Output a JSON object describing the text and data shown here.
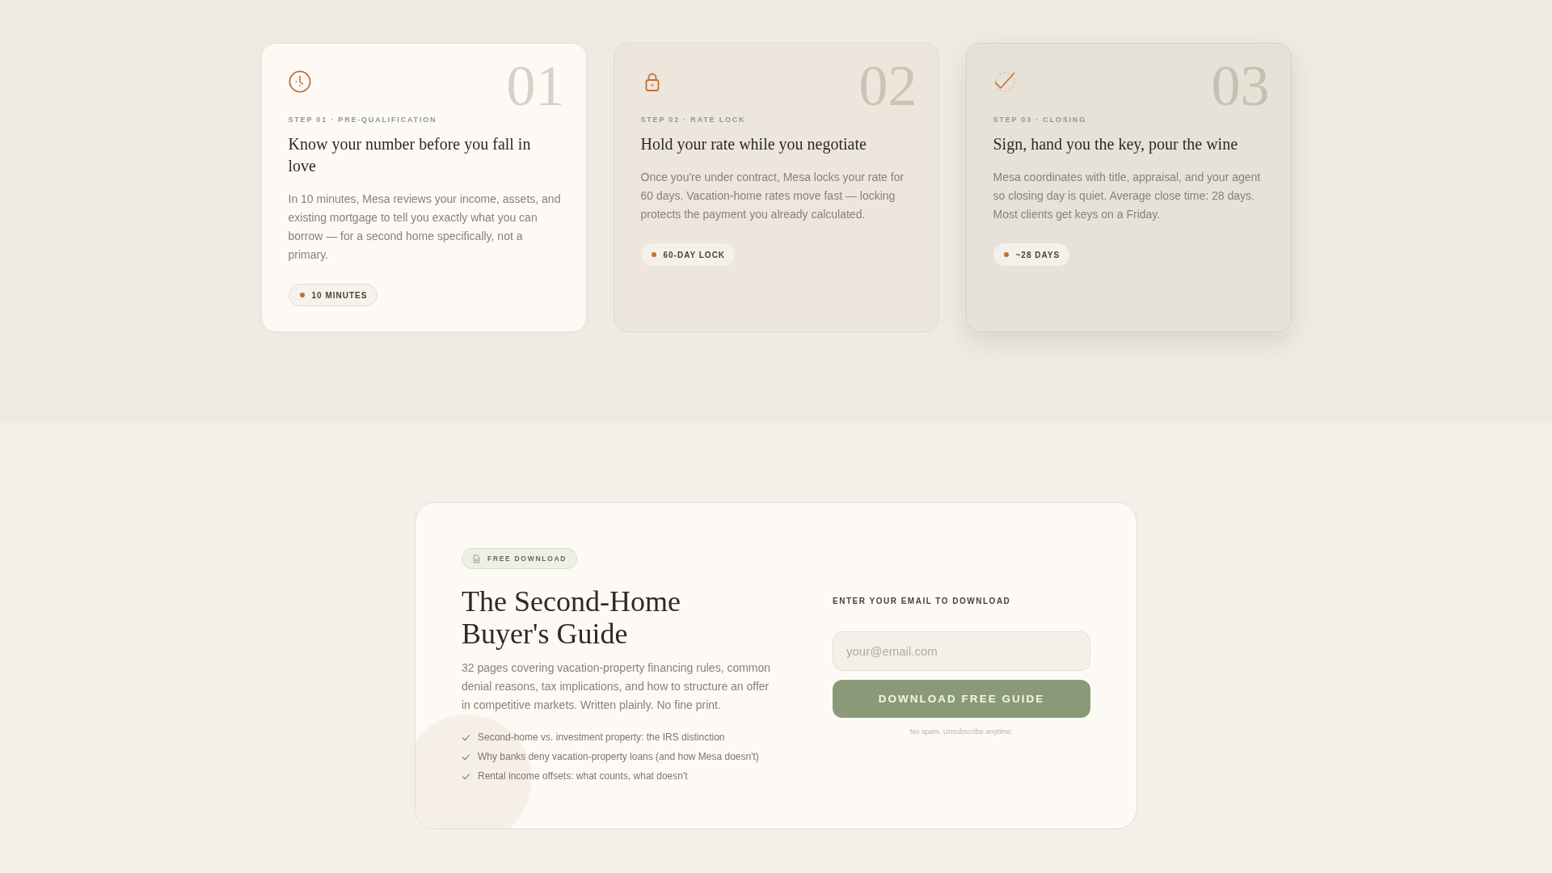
{
  "steps": [
    {
      "kind": "clock",
      "number": "01",
      "label": "STEP 01 · PRE-QUALIFICATION",
      "title": "Know your number before you fall in love",
      "body": "In 10 minutes, Mesa reviews your income, assets, and existing mortgage to tell you exactly what you can borrow — for a second home specifically, not a primary.",
      "badge": "10 MINUTES"
    },
    {
      "kind": "lock",
      "number": "02",
      "label": "STEP 02 · RATE LOCK",
      "title": "Hold your rate while you negotiate",
      "body": "Once you're under contract, Mesa locks your rate for 60 days. Vacation-home rates move fast — locking protects the payment you already calculated.",
      "badge": "60-DAY LOCK"
    },
    {
      "kind": "check",
      "number": "03",
      "label": "STEP 03 · CLOSING",
      "title": "Sign, hand you the key, pour the wine",
      "body": "Mesa coordinates with title, appraisal, and your agent so closing day is quiet. Average close time: 28 days. Most clients get keys on a Friday.",
      "badge": "~28 DAYS"
    }
  ],
  "guide": {
    "tag": "FREE DOWNLOAD",
    "title": "The Second-Home Buyer's Guide",
    "description": "32 pages covering vacation-property financing rules, common denial reasons, tax implications, and how to structure an offer in competitive markets. Written plainly. No fine print.",
    "points": [
      "Second-home vs. investment property: the IRS distinction",
      "Why banks deny vacation-property loans (and how Mesa doesn't)",
      "Rental income offsets: what counts, what doesn't"
    ],
    "form": {
      "label": "ENTER YOUR EMAIL TO DOWNLOAD",
      "email": {
        "placeholder": "your@email.com"
      },
      "button": "DOWNLOAD FREE GUIDE",
      "note": "No spam. Unsubscribe anytime."
    }
  }
}
